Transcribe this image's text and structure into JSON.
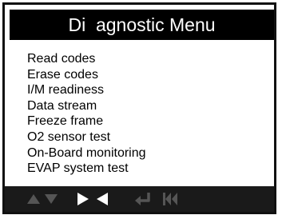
{
  "window": {
    "title": "Di  agnostic Menu"
  },
  "menu": {
    "items": [
      {
        "label": "Read codes"
      },
      {
        "label": "Erase codes"
      },
      {
        "label": "I/M readiness"
      },
      {
        "label": "Data stream"
      },
      {
        "label": "Freeze frame"
      },
      {
        "label": "O2 sensor test"
      },
      {
        "label": "On-Board monitoring"
      },
      {
        "label": "EVAP system test"
      }
    ]
  },
  "toolbar": {
    "buttons": [
      {
        "icon": "up-arrow-icon",
        "state": "inactive"
      },
      {
        "icon": "down-arrow-icon",
        "state": "inactive"
      },
      {
        "icon": "right-arrow-icon",
        "state": "active"
      },
      {
        "icon": "left-arrow-icon",
        "state": "active"
      },
      {
        "icon": "return-icon",
        "state": "inactive"
      },
      {
        "icon": "skip-back-icon",
        "state": "inactive"
      }
    ],
    "colors": {
      "active": "#ffffff",
      "inactive": "#555555",
      "background": "#1a1a1a"
    }
  },
  "colors": {
    "title_background": "#000000",
    "title_text": "#ffffff",
    "frame_border": "#111111"
  }
}
